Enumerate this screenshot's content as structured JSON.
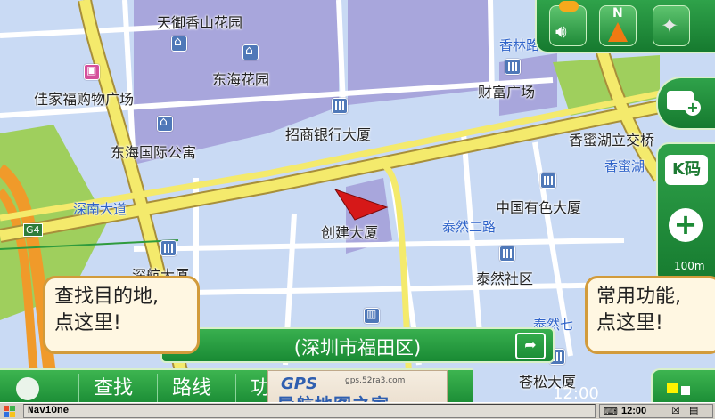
{
  "map": {
    "pois": [
      {
        "id": "tianyu",
        "label": "天御香山花园",
        "icon": "home-icon"
      },
      {
        "id": "donghai-garden",
        "label": "东海花园",
        "icon": "home-icon"
      },
      {
        "id": "jiajiafu",
        "label": "佳家福购物广场",
        "icon": "shop-icon"
      },
      {
        "id": "caifu",
        "label": "财富广场",
        "icon": "building-icon"
      },
      {
        "id": "zhaoshang",
        "label": "招商银行大厦",
        "icon": "building-icon"
      },
      {
        "id": "donghai-apt",
        "label": "东海国际公寓",
        "icon": "home-icon"
      },
      {
        "id": "xiangmi-interchange",
        "label": "香蜜湖立交桥",
        "icon": ""
      },
      {
        "id": "youse",
        "label": "中国有色大厦",
        "icon": "building-icon"
      },
      {
        "id": "chuangjian",
        "label": "创建大厦",
        "icon": ""
      },
      {
        "id": "shenhang",
        "label": "深航大厦",
        "icon": "building-icon"
      },
      {
        "id": "tairan-community",
        "label": "泰然社区",
        "icon": "building-icon"
      },
      {
        "id": "cangsong",
        "label": "苍松大厦",
        "icon": "building-icon"
      }
    ],
    "roads": [
      {
        "id": "xianglin",
        "label": "香林路"
      },
      {
        "id": "xiangmi-road",
        "label": "香蜜湖"
      },
      {
        "id": "shennan",
        "label": "深南大道"
      },
      {
        "id": "tairan-2",
        "label": "泰然二路"
      },
      {
        "id": "tairan-7",
        "label": "泰然七"
      },
      {
        "id": "g4",
        "label": "G4"
      }
    ],
    "colors": {
      "background": "#c9daf4",
      "main_road": "#f4ea6c",
      "minor_road": "#ffffff",
      "block": "#a8a6dc",
      "green": "#9fcf5d",
      "expressway": "#f09a2a",
      "car_marker": "#d61818"
    }
  },
  "status_bar": {
    "compass_label": "N",
    "icons": [
      "speaker-icon",
      "compass-icon",
      "gps-satellite-icon"
    ]
  },
  "side_controls": {
    "kcode_label": "K码",
    "zoom_in_label": "+",
    "scale_label": "100m",
    "camera_icon": "camera-add-icon"
  },
  "address_bar": {
    "text": "(深圳市福田区)",
    "share_icon": "share-icon"
  },
  "bottom_menu": {
    "items": [
      {
        "id": "find",
        "label": "查找"
      },
      {
        "id": "route",
        "label": "路线"
      },
      {
        "id": "func",
        "label": "功"
      }
    ],
    "clock_partial": "12:00"
  },
  "callouts": {
    "left": [
      "查找目的地,",
      "点这里!"
    ],
    "right": [
      "常用功能,",
      "点这里!"
    ]
  },
  "watermark": {
    "gps": "GPS",
    "url": "gps.52ra3.com",
    "title": "导航地图之家"
  },
  "taskbar": {
    "task_label": "NaviOne",
    "time": "12:00"
  }
}
